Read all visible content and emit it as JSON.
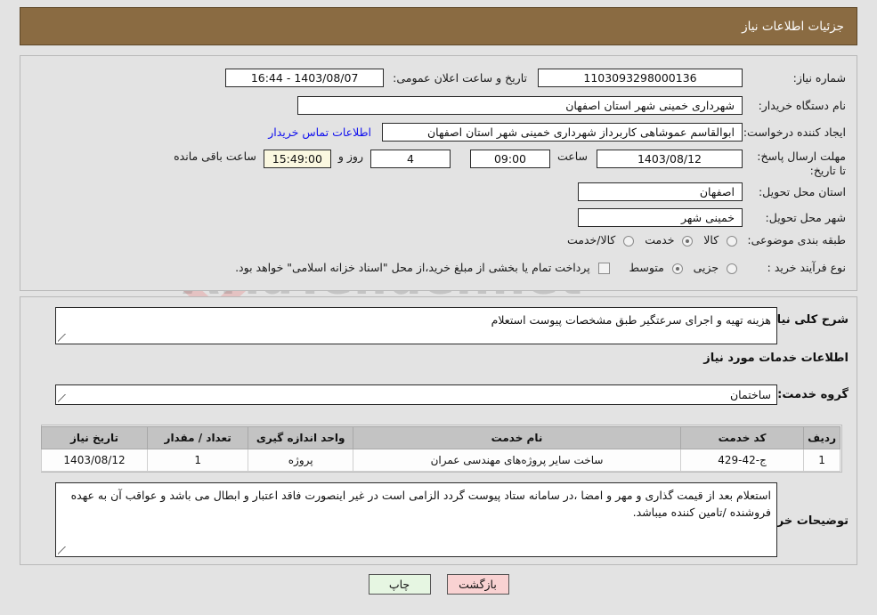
{
  "header": {
    "title": "جزئیات اطلاعات نیاز"
  },
  "colors": {
    "header_bg": "#8a6b42",
    "page_bg": "#e3e3e3",
    "link": "#1010ee",
    "highlight_field": "#fbf8e0",
    "back_button": "#f9d2d2",
    "print_button": "#e6f6e2"
  },
  "watermark": {
    "text": "AriaTender.net"
  },
  "form": {
    "need_number_label": "شماره نیاز:",
    "need_number_value": "1103093298000136",
    "announce_datetime_label": "تاریخ و ساعت اعلان عمومی:",
    "announce_datetime_value": "1403/08/07 - 16:44",
    "buyer_org_label": "نام دستگاه خریدار:",
    "buyer_org_value": "شهرداری خمینی شهر استان اصفهان",
    "requester_label": "ایجاد کننده درخواست:",
    "requester_value": "ابوالقاسم عموشاهی کاربرداز شهرداری خمینی شهر استان اصفهان",
    "contact_link": "اطلاعات تماس خریدار",
    "deadline_label": "مهلت ارسال پاسخ: تا تاریخ:",
    "deadline_date": "1403/08/12",
    "deadline_time_label": "ساعت",
    "deadline_time": "09:00",
    "remaining_days": "4",
    "remaining_days_label": "روز و",
    "remaining_time": "15:49:00",
    "remaining_suffix": "ساعت باقی مانده",
    "province_label": "استان محل تحویل:",
    "province_value": "اصفهان",
    "city_label": "شهر محل تحویل:",
    "city_value": "خمینی شهر",
    "category_label": "طبقه بندی موضوعی:",
    "category_options": [
      {
        "label": "کالا",
        "selected": false
      },
      {
        "label": "خدمت",
        "selected": true
      },
      {
        "label": "کالا/خدمت",
        "selected": false
      }
    ],
    "process_label": "نوع فرآیند خرید :",
    "process_options": [
      {
        "label": "جزیی",
        "selected": false
      },
      {
        "label": "متوسط",
        "selected": true
      }
    ],
    "treasury_checkbox_label": "پرداخت تمام یا بخشی از مبلغ خرید،از محل \"اسناد خزانه اسلامی\" خواهد بود.",
    "treasury_checked": false
  },
  "description": {
    "label": "شرح کلی نیاز:",
    "value": "هزینه تهیه و اجرای سرعتگیر طبق مشخصات پیوست استعلام"
  },
  "services_section": {
    "heading": "اطلاعات خدمات مورد نیاز",
    "group_label": "گروه خدمت:",
    "group_value": "ساختمان"
  },
  "table": {
    "columns": [
      "ردیف",
      "کد خدمت",
      "نام خدمت",
      "واحد اندازه گیری",
      "تعداد / مقدار",
      "تاریخ نیاز"
    ],
    "rows": [
      {
        "row_no": "1",
        "service_code": "ج-42-429",
        "service_name": "ساخت سایر پروژه‌های مهندسی عمران",
        "unit": "پروژه",
        "quantity": "1",
        "need_date": "1403/08/12"
      }
    ]
  },
  "buyer_notes": {
    "label": "توضیحات خریدار:",
    "value": "استعلام بعد از قیمت گذاری و مهر و امضا ،در سامانه ستاد پیوست گردد الزامی است در غیر اینصورت فاقد اعتبار و ابطال می باشد و عواقب آن به عهده فروشنده /تامین کننده میباشد."
  },
  "footer": {
    "back_label": "بازگشت",
    "print_label": "چاپ"
  }
}
